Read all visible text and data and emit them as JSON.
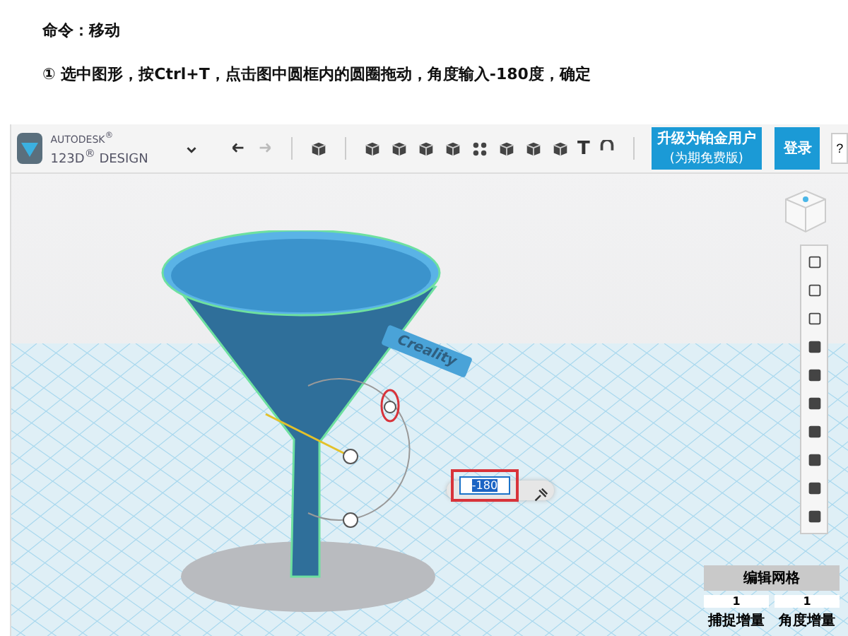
{
  "instruction": {
    "title": "命令：移动",
    "step": "① 选中图形，按Ctrl+T，点击图中圆框内的圆圈拖动，角度输入-180度，确定"
  },
  "app": {
    "logo": {
      "brand": "AUTODESK$^{®}$",
      "product": "123D$^{®}$ DESIGN"
    },
    "toolbar": {
      "text_tool": "T"
    },
    "upgrade_button": {
      "label": "升级为铂金用户",
      "sublabel": "(为期免费版)"
    },
    "login_button": "登录",
    "help_button": "?"
  },
  "viewport": {
    "model_label": "Creality",
    "angle_input": {
      "value": "-180",
      "text_selected": true,
      "highlighted": true
    },
    "edit_grid": {
      "title": "编辑网格",
      "fields": [
        {
          "value": "1",
          "label": "捕捉增量"
        },
        {
          "value": "1",
          "label": "角度增量"
        }
      ]
    }
  }
}
